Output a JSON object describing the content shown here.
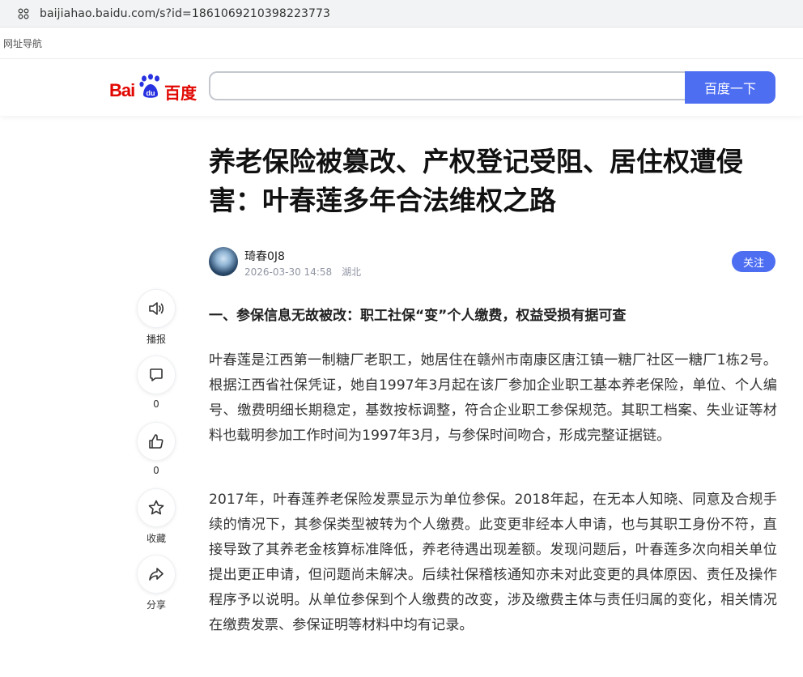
{
  "browser": {
    "url": "baijiahao.baidu.com/s?id=1861069210398223773",
    "bookmark": "网址导航"
  },
  "header": {
    "logo_bai": "Bai",
    "logo_du": "du",
    "logo_cn": "百度",
    "search_placeholder": "",
    "search_button": "百度一下"
  },
  "article": {
    "title": "养老保险被篡改、产权登记受阻、居住权遭侵害：叶春莲多年合法维权之路",
    "author": "琦春0J8",
    "date": "2026-03-30 14:58",
    "location": "湖北",
    "follow": "关注",
    "section1": "一、参保信息无故被改：职工社保“变”个人缴费，权益受损有据可查",
    "paragraph1": "叶春莲是江西第一制糖厂老职工，她居住在赣州市南康区唐江镇一糖厂社区一糖厂1栋2号。根据江西省社保凭证，她自1997年3月起在该厂参加企业职工基本养老保险，单位、个人编号、缴费明细长期稳定，基数按标调整，符合企业职工参保规范。其职工档案、失业证等材料也载明参加工作时间为1997年3月，与参保时间吻合，形成完整证据链。",
    "paragraph2": "2017年，叶春莲养老保险发票显示为单位参保。2018年起，在无本人知晓、同意及合规手续的情况下，其参保类型被转为个人缴费。此变更非经本人申请，也与其职工身份不符，直接导致了其养老金核算标准降低，养老待遇出现差额。发现问题后，叶春莲多次向相关单位提出更正申请，但问题尚未解决。后续社保稽核通知亦未对此变更的具体原因、责任及操作程序予以说明。从单位参保到个人缴费的改变，涉及缴费主体与责任归属的变化，相关情况在缴费发票、参保证明等材料中均有记录。"
  },
  "side_actions": [
    {
      "label": "播报",
      "icon": "speaker-icon"
    },
    {
      "label": "0",
      "icon": "comment-icon"
    },
    {
      "label": "0",
      "icon": "thumbs-up-icon"
    },
    {
      "label": "收藏",
      "icon": "star-icon"
    },
    {
      "label": "分享",
      "icon": "share-icon"
    }
  ],
  "colors": {
    "brand_red": "#e10601",
    "brand_blue": "#4e6ef2",
    "paw_blue": "#2932e1"
  }
}
